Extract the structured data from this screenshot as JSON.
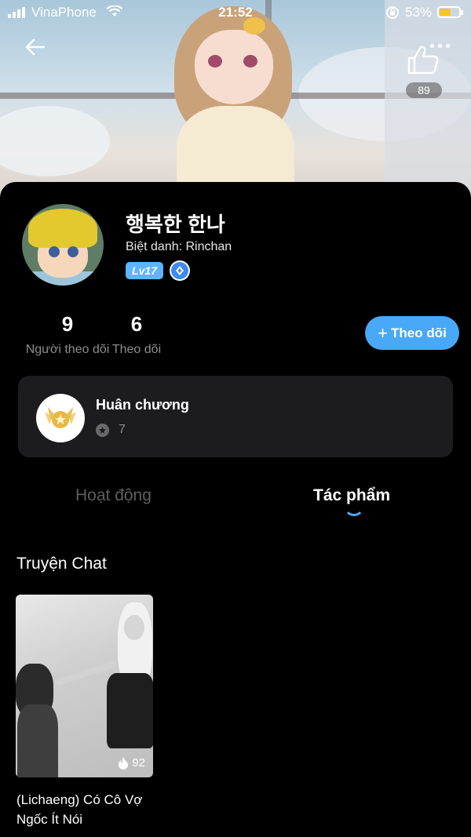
{
  "status_bar": {
    "carrier": "VinaPhone",
    "time": "21:52",
    "battery_percent": "53%"
  },
  "header": {
    "like_count": "89"
  },
  "profile": {
    "display_name": "행복한 한나",
    "nickname": "Biệt danh: Rinchan",
    "level": "Lv17"
  },
  "stats": {
    "followers_count": "9",
    "followers_label": "Người theo dõi",
    "following_count": "6",
    "following_label": "Theo dõi"
  },
  "actions": {
    "follow_label": "Theo dõi"
  },
  "medals": {
    "title": "Huân chương",
    "count": "7"
  },
  "tabs": [
    {
      "label": "Hoạt động",
      "active": false
    },
    {
      "label": "Tác phẩm",
      "active": true
    }
  ],
  "section": {
    "title": "Truyện Chat"
  },
  "stories": [
    {
      "title": "(Lichaeng) Có Cô Vợ Ngốc Ít Nói",
      "views": "92"
    }
  ],
  "colors": {
    "accent": "#49a8f8",
    "level_badge": "#5fb4ff",
    "background": "#000000",
    "card": "#1c1c1e"
  }
}
